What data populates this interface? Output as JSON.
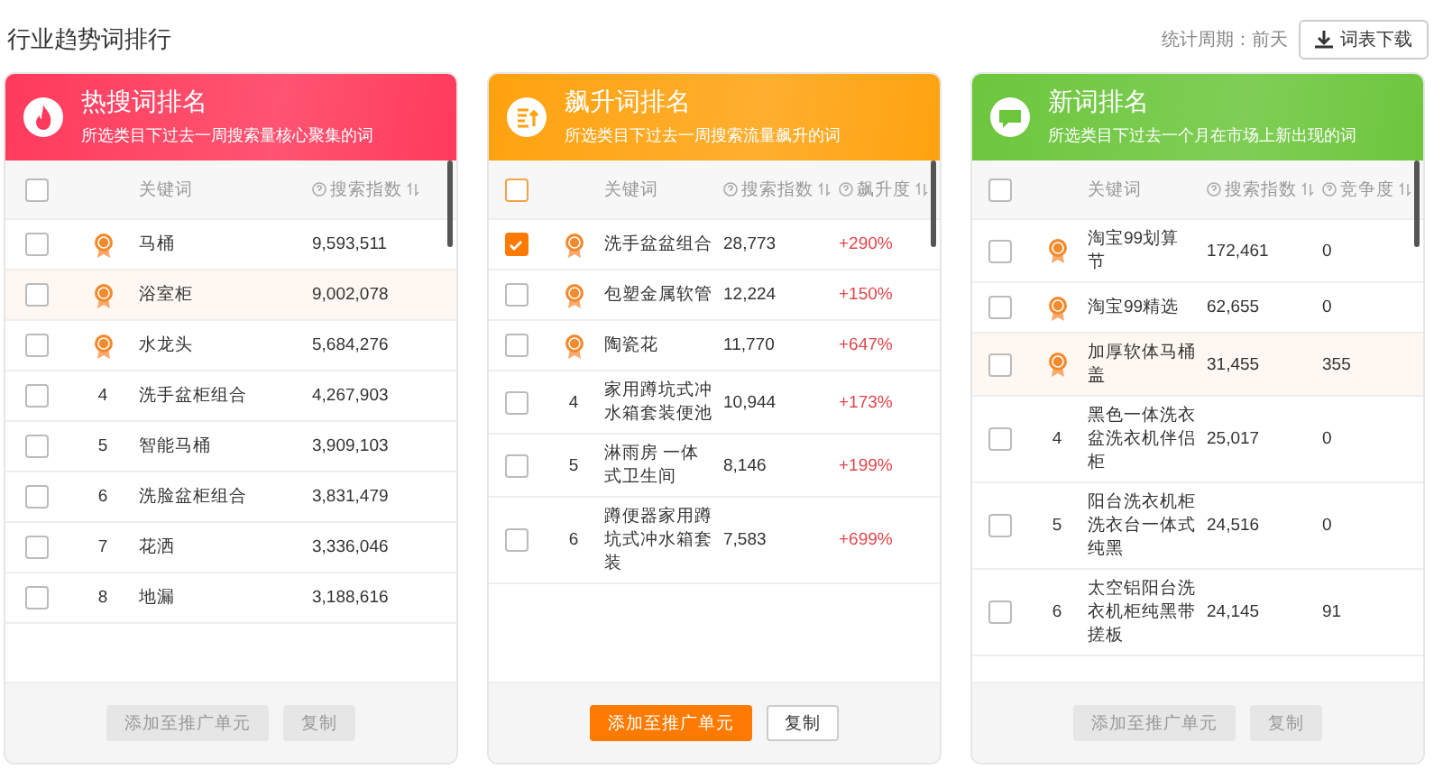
{
  "page_title": "行业趋势词排行",
  "period": "统计周期：前天",
  "download_button": "词表下载",
  "panels": [
    {
      "kind": "hot",
      "color": "#ff3a5c",
      "title": "热搜词排名",
      "subtitle": "所选类目下过去一周搜索量核心聚集的词",
      "select_all_hovered": false,
      "keyword_header": "关键词",
      "metric_headers": [
        "搜索指数"
      ],
      "rows": [
        {
          "kind": "medal",
          "checked": false,
          "hovered": false,
          "cells": [
            "马桶",
            "9,593,511"
          ]
        },
        {
          "kind": "medal",
          "checked": false,
          "hovered": true,
          "cells": [
            "浴室柜",
            "9,002,078"
          ]
        },
        {
          "kind": "medal",
          "checked": false,
          "hovered": false,
          "cells": [
            "水龙头",
            "5,684,276"
          ]
        },
        {
          "rank": "4",
          "kind": "number",
          "checked": false,
          "hovered": false,
          "cells": [
            "洗手盆柜组合",
            "4,267,903"
          ]
        },
        {
          "rank": "5",
          "kind": "number",
          "checked": false,
          "hovered": false,
          "cells": [
            "智能马桶",
            "3,909,103"
          ]
        },
        {
          "rank": "6",
          "kind": "number",
          "checked": false,
          "hovered": false,
          "cells": [
            "洗脸盆柜组合",
            "3,831,479"
          ]
        },
        {
          "rank": "7",
          "kind": "number",
          "checked": false,
          "hovered": false,
          "cells": [
            "花洒",
            "3,336,046"
          ]
        },
        {
          "rank": "8",
          "kind": "number",
          "checked": false,
          "hovered": false,
          "cells": [
            "地漏",
            "3,188,616"
          ]
        }
      ],
      "add_button": {
        "label": "添加至推广单元",
        "disabled": true
      },
      "copy_button": {
        "label": "复制",
        "disabled": true
      }
    },
    {
      "kind": "rise",
      "color": "#ffa20f",
      "title": "飙升词排名",
      "subtitle": "所选类目下过去一周搜索流量飙升的词",
      "select_all_hovered": true,
      "keyword_header": "关键词",
      "metric_headers": [
        "搜索指数",
        "飙升度"
      ],
      "rows": [
        {
          "kind": "medal",
          "checked": true,
          "hovered": false,
          "cells": [
            "洗手盆盆组合",
            "28,773",
            "+290%"
          ]
        },
        {
          "kind": "medal",
          "checked": false,
          "hovered": false,
          "cells": [
            "包塑金属软管",
            "12,224",
            "+150%"
          ]
        },
        {
          "kind": "medal",
          "checked": false,
          "hovered": false,
          "cells": [
            "陶瓷花",
            "11,770",
            "+647%"
          ]
        },
        {
          "rank": "4",
          "kind": "number",
          "checked": false,
          "hovered": false,
          "cells": [
            "家用蹲坑式冲水箱套装便池",
            "10,944",
            "+173%"
          ]
        },
        {
          "rank": "5",
          "kind": "number",
          "checked": false,
          "hovered": false,
          "cells": [
            "淋雨房 一体式卫生间",
            "8,146",
            "+199%"
          ]
        },
        {
          "rank": "6",
          "kind": "number",
          "checked": false,
          "hovered": false,
          "cells": [
            "蹲便器家用蹲坑式冲水箱套装",
            "7,583",
            "+699%"
          ]
        }
      ],
      "add_button": {
        "label": "添加至推广单元",
        "disabled": false
      },
      "copy_button": {
        "label": "复制",
        "disabled": false
      }
    },
    {
      "kind": "new",
      "color": "#6cc63c",
      "title": "新词排名",
      "subtitle": "所选类目下过去一个月在市场上新出现的词",
      "select_all_hovered": false,
      "keyword_header": "关键词",
      "metric_headers": [
        "搜索指数",
        "竞争度"
      ],
      "rows": [
        {
          "kind": "medal",
          "checked": false,
          "hovered": false,
          "cells": [
            "淘宝99划算节",
            "172,461",
            "0"
          ]
        },
        {
          "kind": "medal",
          "checked": false,
          "hovered": false,
          "cells": [
            "淘宝99精选",
            "62,655",
            "0"
          ]
        },
        {
          "kind": "medal",
          "checked": false,
          "hovered": true,
          "cells": [
            "加厚软体马桶盖",
            "31,455",
            "355"
          ]
        },
        {
          "rank": "4",
          "kind": "number",
          "checked": false,
          "hovered": false,
          "cells": [
            "黑色一体洗衣盆洗衣机伴侣柜",
            "25,017",
            "0"
          ]
        },
        {
          "rank": "5",
          "kind": "number",
          "checked": false,
          "hovered": false,
          "cells": [
            "阳台洗衣机柜洗衣台一体式纯黑",
            "24,516",
            "0"
          ]
        },
        {
          "rank": "6",
          "kind": "number",
          "checked": false,
          "hovered": false,
          "cells": [
            "太空铝阳台洗衣机柜纯黑带搓板",
            "24,145",
            "91"
          ]
        }
      ],
      "add_button": {
        "label": "添加至推广单元",
        "disabled": true
      },
      "copy_button": {
        "label": "复制",
        "disabled": true
      }
    }
  ]
}
